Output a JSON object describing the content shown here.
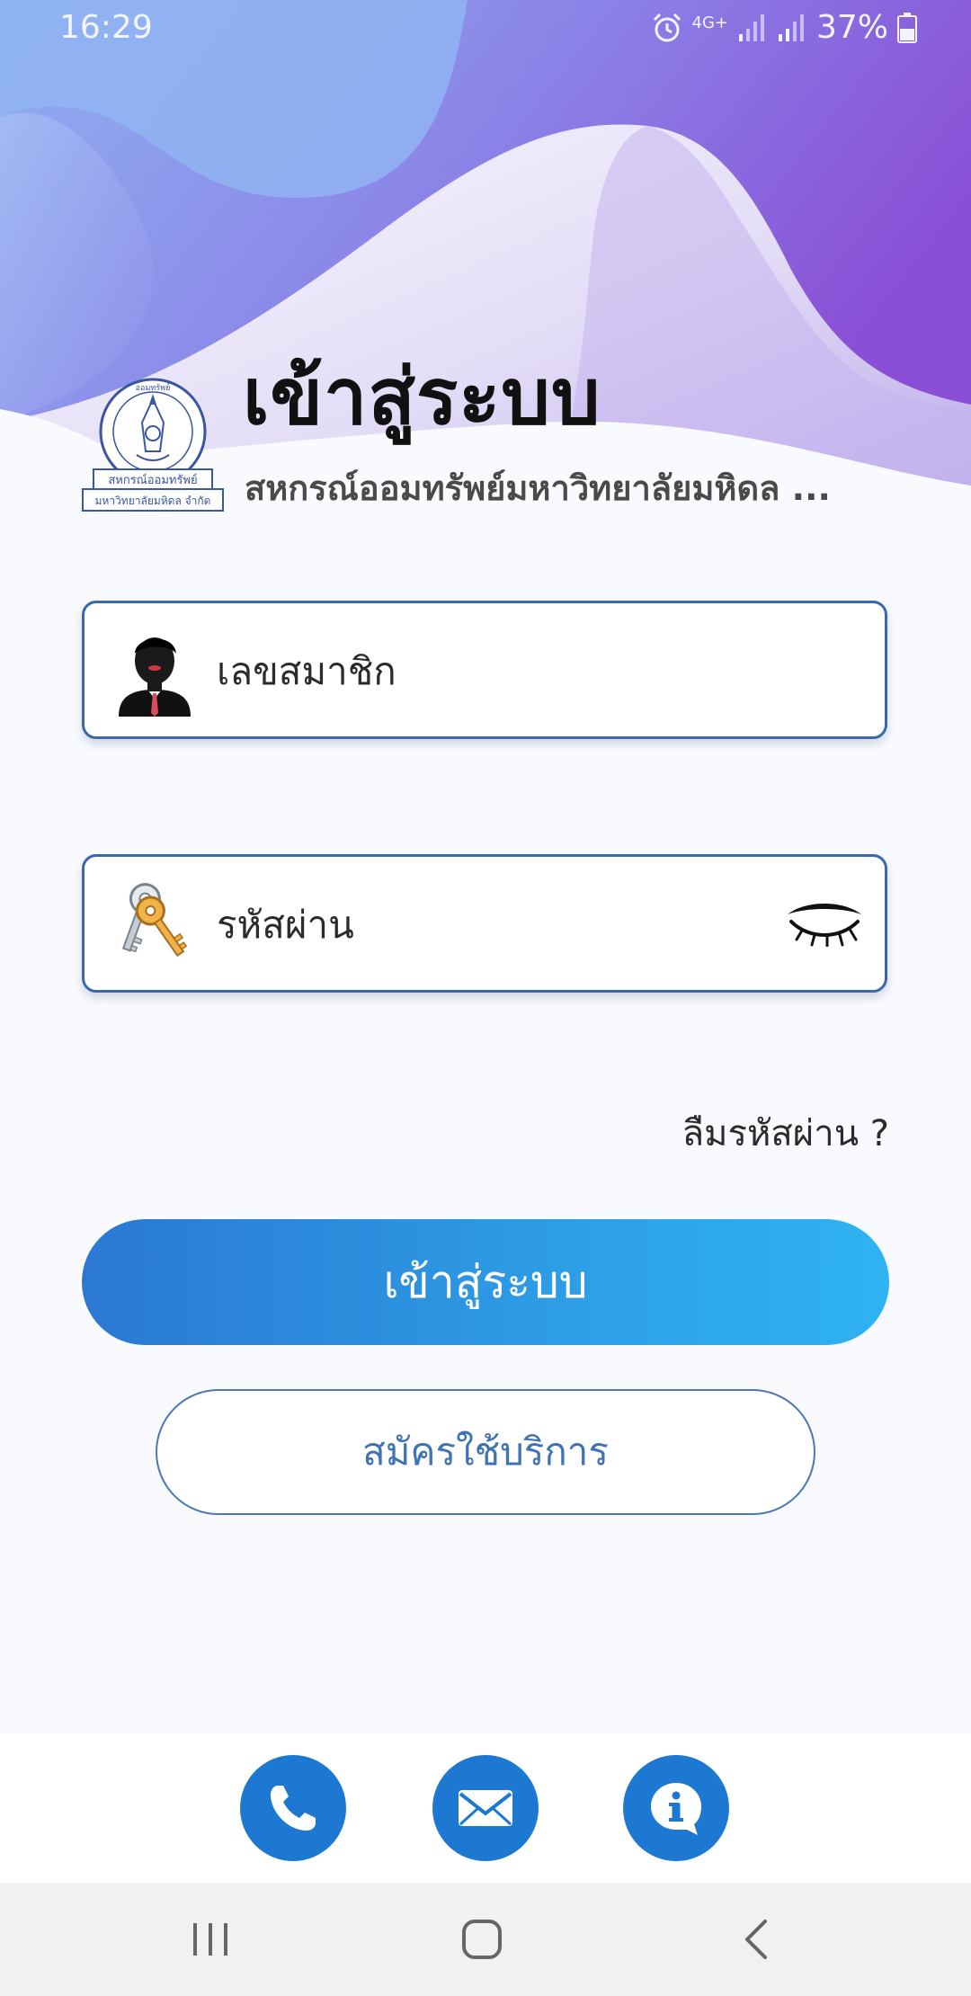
{
  "status_bar": {
    "time": "16:29",
    "network": "4G+",
    "battery": "37%",
    "icons": [
      "alarm-icon",
      "network-4g-icon",
      "signal-icon",
      "signal-icon",
      "battery-icon"
    ]
  },
  "header": {
    "title": "เข้าสู่ระบบ",
    "subtitle": "สหกรณ์ออมทรัพย์มหาวิทยาลัยมหิดล ..."
  },
  "logo": {
    "icon": "coop-logo",
    "arc_text": "ออมทรัพย์",
    "label_line1": "สหกรณ์ออมทรัพย์",
    "label_line2": "มหาวิทยาลัยมหิดล จำกัด"
  },
  "form": {
    "member_placeholder": "เลขสมาชิก",
    "member_icon": "businessman-icon",
    "password_placeholder": "รหัสผ่าน",
    "password_icon": "keys-icon",
    "eye_icon": "eye-closed-icon",
    "forgot_label": "ลืมรหัสผ่าน ?",
    "login_label": "เข้าสู่ระบบ",
    "register_label": "สมัครใช้บริการ"
  },
  "contact_bar": {
    "buttons": [
      "phone-icon",
      "mail-icon",
      "info-icon"
    ],
    "button_color": "#1d78d2"
  },
  "nav_bar": {
    "buttons": [
      "recent-apps-icon",
      "home-icon",
      "back-icon"
    ]
  },
  "colors": {
    "accent": "#2d9ee6",
    "field_border": "#3a67ad",
    "header_purple": "#8a52d8",
    "header_blue": "#8ea8ef"
  }
}
